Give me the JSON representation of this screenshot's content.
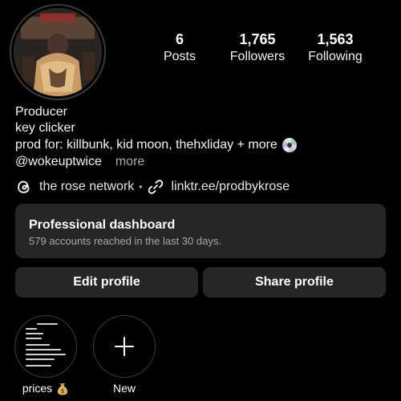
{
  "profile": {
    "stats": [
      {
        "value": "6",
        "label": "Posts"
      },
      {
        "value": "1,765",
        "label": "Followers"
      },
      {
        "value": "1,563",
        "label": "Following"
      }
    ],
    "bio": {
      "line1": "Producer",
      "line2": "key clicker",
      "line3": "prod for: killbunk, kid moon, thehxliday + more",
      "line3_icon": "cd-disc-icon",
      "handle": "@wokeuptwice",
      "more": "more"
    },
    "links": {
      "threads_icon": "threads-icon",
      "network": "the rose network",
      "separator": "•",
      "link_icon": "link-icon",
      "url": "linktr.ee/prodbykrose"
    }
  },
  "dashboard": {
    "title": "Professional dashboard",
    "subtitle": "579 accounts reached in the last 30 days."
  },
  "actions": {
    "edit": "Edit profile",
    "share": "Share profile"
  },
  "highlights": [
    {
      "label": "prices",
      "icon": "money-bag-icon"
    },
    {
      "label": "New",
      "icon": "plus-icon"
    }
  ],
  "colors": {
    "background": "#000000",
    "card": "#262626",
    "muted_text": "#a8a8a8"
  }
}
